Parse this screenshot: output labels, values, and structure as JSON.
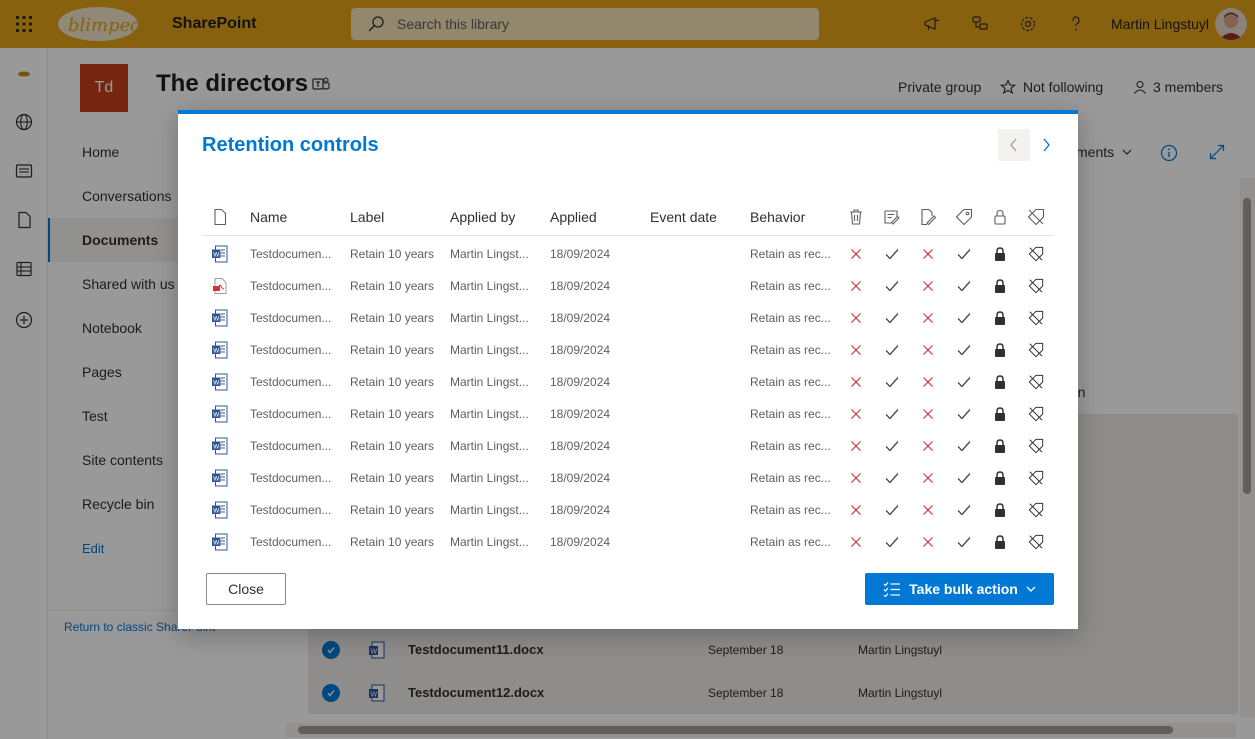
{
  "suite": {
    "app_name": "SharePoint",
    "search_placeholder": "Search this library",
    "user_name": "Martin Lingstuyl",
    "logo_text": "blimped"
  },
  "site": {
    "logo_initials": "Td",
    "title": "The directors",
    "privacy": "Private group",
    "follow": "Not following",
    "members": "3 members"
  },
  "nav": {
    "items": [
      {
        "label": "Home"
      },
      {
        "label": "Conversations"
      },
      {
        "label": "Documents"
      },
      {
        "label": "Shared with us"
      },
      {
        "label": "Notebook"
      },
      {
        "label": "Pages"
      },
      {
        "label": "Test"
      },
      {
        "label": "Site contents"
      },
      {
        "label": "Recycle bin"
      }
    ],
    "edit": "Edit",
    "classic_link": "Return to classic SharePoint"
  },
  "library": {
    "view_label": "ments",
    "column_partial": "mn",
    "rows": [
      {
        "name": "Testdocument11.docx",
        "modified": "September 18",
        "author": "Martin Lingstuyl"
      },
      {
        "name": "Testdocument12.docx",
        "modified": "September 18",
        "author": "Martin Lingstuyl"
      }
    ]
  },
  "dialog": {
    "title": "Retention controls",
    "columns": {
      "name": "Name",
      "label": "Label",
      "applied_by": "Applied by",
      "applied": "Applied",
      "event_date": "Event date",
      "behavior": "Behavior"
    },
    "icon_columns": [
      "delete-icon",
      "edit-properties-icon",
      "edit-content-icon",
      "label-tag-icon",
      "lock-icon",
      "unlabel-icon"
    ],
    "rows": [
      {
        "file_type": "word",
        "name": "Testdocumen...",
        "label": "Retain 10 years",
        "applied_by": "Martin Lingst...",
        "applied": "18/09/2024",
        "event_date": "",
        "behavior": "Retain as rec..."
      },
      {
        "file_type": "pdf",
        "name": "Testdocumen...",
        "label": "Retain 10 years",
        "applied_by": "Martin Lingst...",
        "applied": "18/09/2024",
        "event_date": "",
        "behavior": "Retain as rec..."
      },
      {
        "file_type": "word",
        "name": "Testdocumen...",
        "label": "Retain 10 years",
        "applied_by": "Martin Lingst...",
        "applied": "18/09/2024",
        "event_date": "",
        "behavior": "Retain as rec..."
      },
      {
        "file_type": "word",
        "name": "Testdocumen...",
        "label": "Retain 10 years",
        "applied_by": "Martin Lingst...",
        "applied": "18/09/2024",
        "event_date": "",
        "behavior": "Retain as rec..."
      },
      {
        "file_type": "word",
        "name": "Testdocumen...",
        "label": "Retain 10 years",
        "applied_by": "Martin Lingst...",
        "applied": "18/09/2024",
        "event_date": "",
        "behavior": "Retain as rec..."
      },
      {
        "file_type": "word",
        "name": "Testdocumen...",
        "label": "Retain 10 years",
        "applied_by": "Martin Lingst...",
        "applied": "18/09/2024",
        "event_date": "",
        "behavior": "Retain as rec..."
      },
      {
        "file_type": "word",
        "name": "Testdocumen...",
        "label": "Retain 10 years",
        "applied_by": "Martin Lingst...",
        "applied": "18/09/2024",
        "event_date": "",
        "behavior": "Retain as rec..."
      },
      {
        "file_type": "word",
        "name": "Testdocumen...",
        "label": "Retain 10 years",
        "applied_by": "Martin Lingst...",
        "applied": "18/09/2024",
        "event_date": "",
        "behavior": "Retain as rec..."
      },
      {
        "file_type": "word",
        "name": "Testdocumen...",
        "label": "Retain 10 years",
        "applied_by": "Martin Lingst...",
        "applied": "18/09/2024",
        "event_date": "",
        "behavior": "Retain as rec..."
      },
      {
        "file_type": "word",
        "name": "Testdocumen...",
        "label": "Retain 10 years",
        "applied_by": "Martin Lingst...",
        "applied": "18/09/2024",
        "event_date": "",
        "behavior": "Retain as rec..."
      }
    ],
    "permissions": [
      "no",
      "yes",
      "no",
      "yes",
      "locked",
      "unlabel"
    ],
    "close_label": "Close",
    "bulk_label": "Take bulk action"
  },
  "colors": {
    "suite_bar": "#e3a21a",
    "accent": "#0078d4",
    "deny": "#d13438",
    "site_logo": "#c43e1c"
  }
}
